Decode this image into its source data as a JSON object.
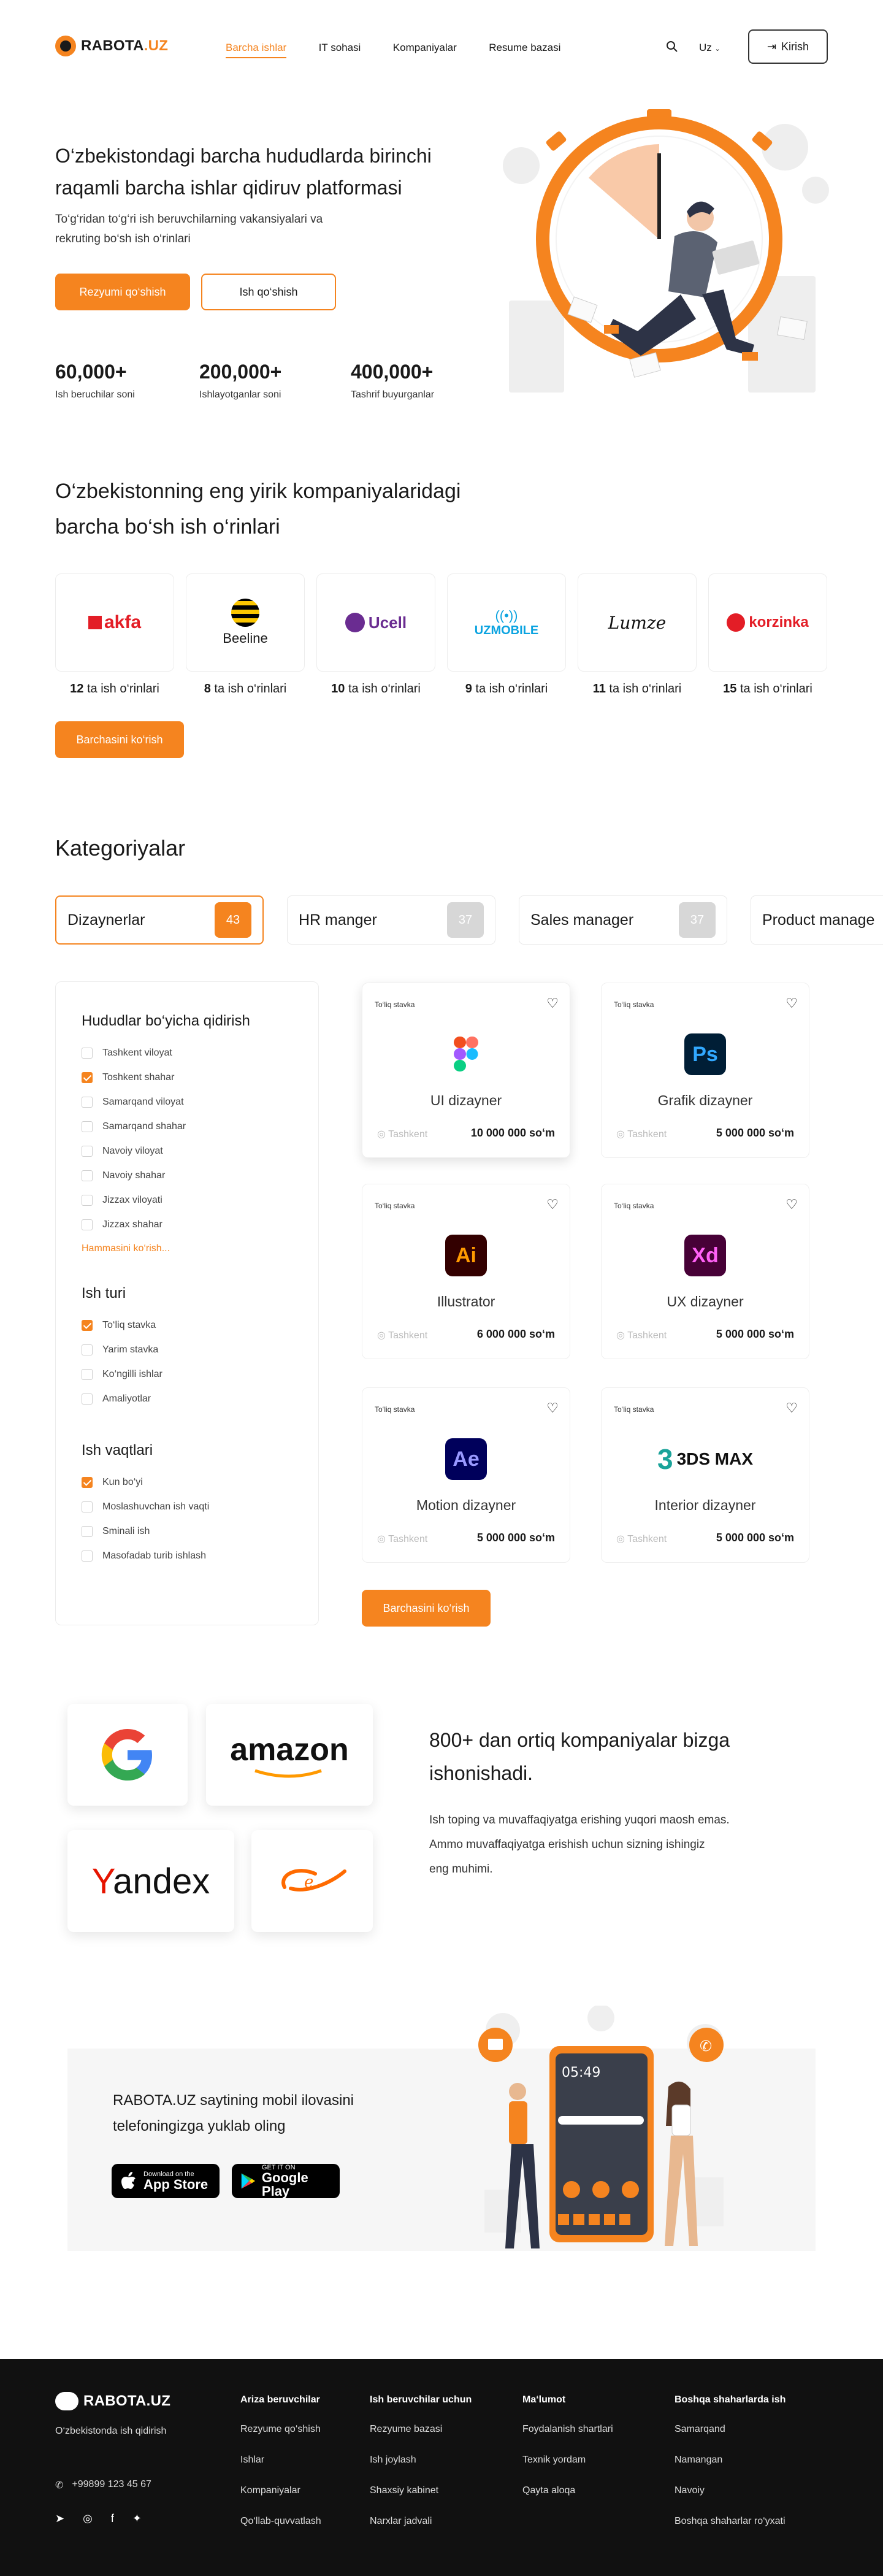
{
  "header": {
    "logo_main": "RABOTA",
    "logo_suffix": ".UZ",
    "nav": [
      "Barcha ishlar",
      "IT sohasi",
      "Kompaniyalar",
      "Resume bazasi"
    ],
    "lang": "Uz",
    "login_label": "Kirish"
  },
  "hero": {
    "title_line1": "O‘zbekistondagi barcha hududlarda birinchi",
    "title_line2": "raqamli  barcha ishlar qidiruv platformasi",
    "subtitle_line1": "To‘g‘ridan to‘g‘ri ish beruvchilarning vakansiyalari va",
    "subtitle_line2": "rekruting bo‘sh ish o‘rinlari",
    "primary_button": "Rezyumi qo‘shish",
    "secondary_button": "Ish qo‘shish",
    "stats": [
      {
        "value": "60,000+",
        "label": "Ish beruchilar soni"
      },
      {
        "value": "200,000+",
        "label": "Ishlayotganlar soni"
      },
      {
        "value": "400,000+",
        "label": "Tashrif buyurganlar"
      }
    ]
  },
  "companies": {
    "title_line1": "O‘zbekistonning eng yirik kompaniyalaridagi",
    "title_line2": "barcha bo‘sh ish o‘rinlari",
    "items": [
      {
        "name": "akfa",
        "count": "12",
        "suffix": " ta ish o‘rinlari"
      },
      {
        "name": "Beeline",
        "count": "8",
        "suffix": " ta ish o‘rinlari"
      },
      {
        "name": "Ucell",
        "count": "10",
        "suffix": " ta ish o‘rinlari"
      },
      {
        "name": "UZMOBILE",
        "count": "9",
        "suffix": " ta ish o‘rinlari"
      },
      {
        "name": "Lumze",
        "count": "11",
        "suffix": " ta ish o‘rinlari"
      },
      {
        "name": "korzinka",
        "count": "15",
        "suffix": " ta ish o‘rinlari"
      }
    ],
    "button": "Barchasini ko‘rish"
  },
  "categories": {
    "title": "Kategoriyalar",
    "tabs": [
      {
        "label": "Dizaynerlar",
        "count": "43"
      },
      {
        "label": "HR manger",
        "count": "37"
      },
      {
        "label": "Sales manager",
        "count": "37"
      },
      {
        "label": "Product manage",
        "count": ""
      }
    ]
  },
  "filters": {
    "region_title": "Hududlar bo‘yicha qidirish",
    "regions": [
      "Tashkent viloyat",
      "Toshkent shahar",
      "Samarqand viloyat",
      "Samarqand shahar",
      "Navoiy viloyat",
      "Navoiy shahar",
      "Jizzax viloyati",
      "Jizzax shahar"
    ],
    "show_all": "Hammasini ko‘rish...",
    "type_title": "Ish turi",
    "types": [
      "To‘liq stavka",
      "Yarim stavka",
      "Ko‘ngilli ishlar",
      "Amaliyotlar"
    ],
    "time_title": "Ish vaqtlari",
    "times": [
      "Kun bo‘yi",
      "Moslashuvchan ish vaqti",
      "Sminali ish",
      "Masofadab turib ishlash"
    ]
  },
  "jobs": {
    "items": [
      {
        "tag": "To‘liq stavka",
        "title": "UI dizayner",
        "location": "Tashkent",
        "salary": "10 000 000 so‘m",
        "icon": "figma-icon"
      },
      {
        "tag": "To‘liq stavka",
        "title": "Grafik dizayner",
        "location": "Tashkent",
        "salary": "5 000 000 so‘m",
        "icon": "photoshop-icon",
        "icon_text": "Ps"
      },
      {
        "tag": "To‘liq stavka",
        "title": "Illustrator",
        "location": "Tashkent",
        "salary": "6 000 000 so‘m",
        "icon": "illustrator-icon",
        "icon_text": "Ai"
      },
      {
        "tag": "To‘liq stavka",
        "title": "UX dizayner",
        "location": "Tashkent",
        "salary": "5 000 000 so‘m",
        "icon": "xd-icon",
        "icon_text": "Xd"
      },
      {
        "tag": "To‘liq stavka",
        "title": "Motion dizayner",
        "location": "Tashkent",
        "salary": "5 000 000 so‘m",
        "icon": "after-effects-icon",
        "icon_text": "Ae"
      },
      {
        "tag": "To‘liq stavka",
        "title": "Interior dizayner",
        "location": "Tashkent",
        "salary": "5 000 000 so‘m",
        "icon": "3dsmax-icon",
        "icon_text": "3DS MAX"
      }
    ],
    "button": "Barchasini ko‘rish"
  },
  "trust": {
    "logos": [
      "Google",
      "amazon",
      "Yandex",
      "Alibaba"
    ],
    "title_line1": "800+ dan ortiq kompaniyalar bizga",
    "title_line2": "ishonishadi.",
    "text_line1": "Ish toping va muvaffaqiyatga erishing yuqori maosh emas.",
    "text_line2": "Ammo muvaffaqiyatga erishish uchun sizning ishingiz",
    "text_line3": "eng muhimi."
  },
  "app": {
    "text_line1": "RABOTA.UZ saytining mobil ilovasini",
    "text_line2": "telefoningizga yuklab oling",
    "appstore_small": "Download on the",
    "appstore_big": "App Store",
    "google_small": "GET IT ON",
    "google_big": "Google Play",
    "phone_time": "05:49"
  },
  "footer": {
    "logo": "RABOTA.UZ",
    "tagline": "O‘zbekistonda ish qidirish",
    "phone": "+99899 123 45 67",
    "cols": [
      {
        "title": "Ariza beruvchilar",
        "items": [
          "Rezyume qo‘shish",
          "Ishlar",
          "Kompaniyalar",
          "Qo‘llab-quvvatlash"
        ]
      },
      {
        "title": "Ish beruvchilar uchun",
        "items": [
          "Rezyume bazasi",
          "Ish joylash",
          "Shaxsiy kabinet",
          "Narxlar jadvali"
        ]
      },
      {
        "title": "Ma‘lumot",
        "items": [
          "Foydalanish shartlari",
          "Texnik yordam",
          "Qayta aloqa"
        ]
      },
      {
        "title": "Boshqa shaharlarda ish",
        "items": [
          "Samarqand",
          "Namangan",
          "Navoiy",
          "Boshqa shaharlar ro‘yxati"
        ]
      }
    ]
  },
  "colors": {
    "accent": "#F5841F",
    "footer_bg": "#111111"
  }
}
